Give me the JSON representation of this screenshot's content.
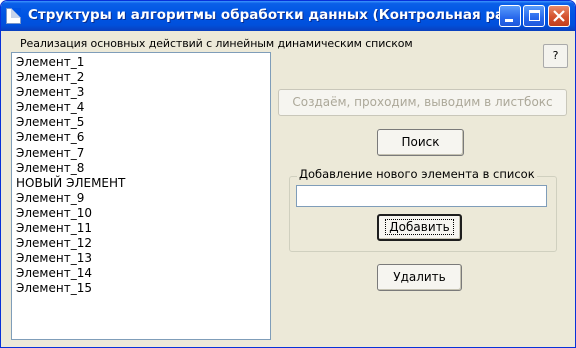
{
  "window": {
    "title": "Структуры и алгоритмы обработки данных (Контрольная ра..."
  },
  "main": {
    "panel_label": "Реализация основных действий с линейным динамическим списком",
    "help_label": "?",
    "list_items": [
      "Элемент_1",
      "Элемент_2",
      "Элемент_3",
      "Элемент_4",
      "Элемент_5",
      "Элемент_6",
      "Элемент_7",
      "Элемент_8",
      "НОВЫЙ ЭЛЕМЕНТ",
      "Элемент_9",
      "Элемент_10",
      "Элемент_11",
      "Элемент_12",
      "Элемент_13",
      "Элемент_14",
      "Элемент_15"
    ],
    "create_button": "Создаём, проходим, выводим в листбокс",
    "search_button": "Поиск",
    "add_group": {
      "label": "Добавление нового элемента в список",
      "input_value": "",
      "add_button": "Добавить"
    },
    "delete_button": "Удалить"
  },
  "colors": {
    "titlebar": "#0054e3",
    "window_bg": "#ece9d8",
    "close_button": "#d4522e",
    "disabled_text": "#aca899"
  }
}
